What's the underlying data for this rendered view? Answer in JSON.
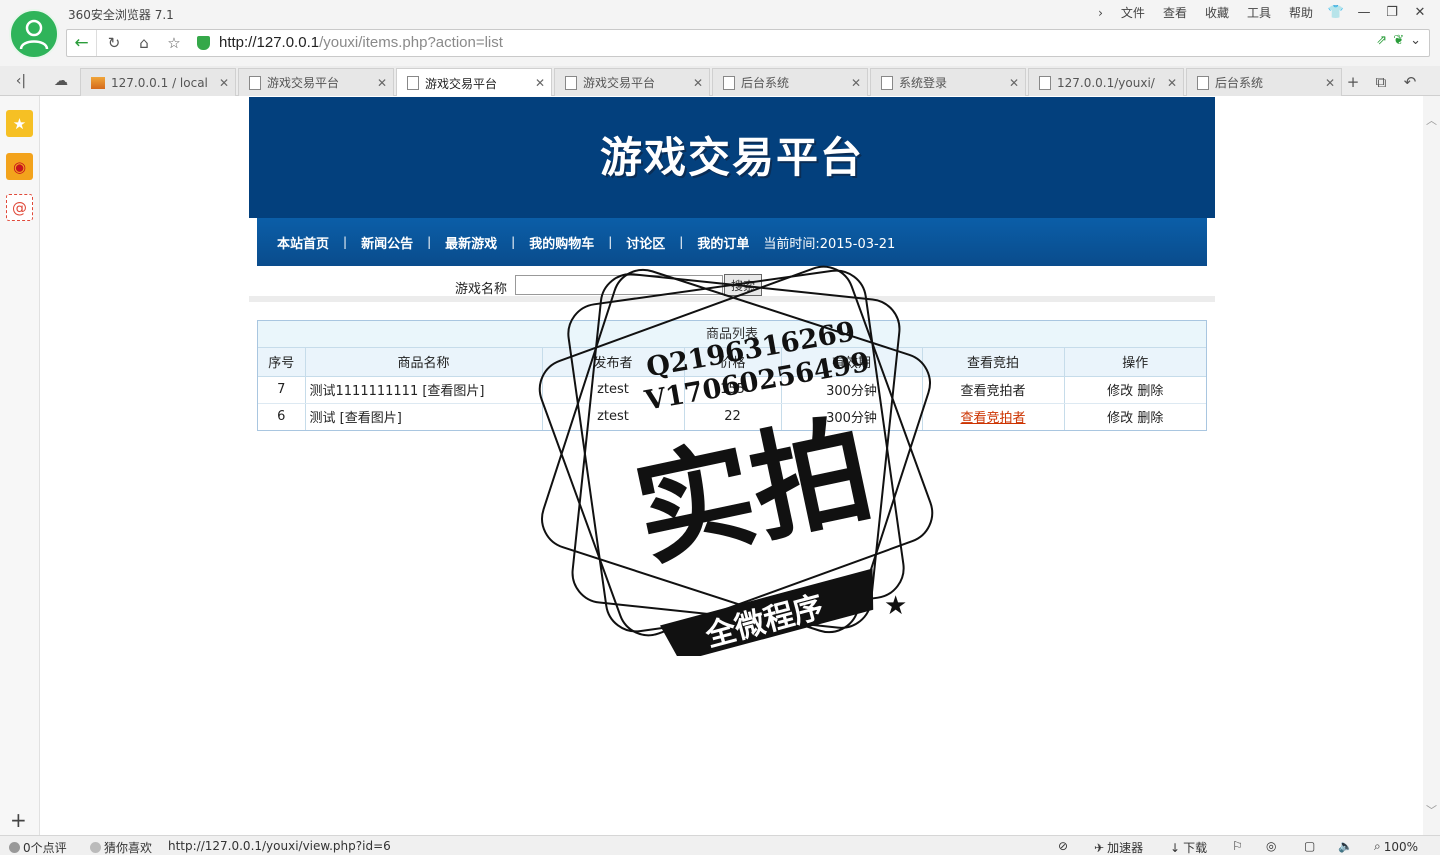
{
  "browser": {
    "title": "360安全浏览器 7.1",
    "menus": [
      "文件",
      "查看",
      "收藏",
      "工具",
      "帮助"
    ],
    "url_host": "http://127.0.0.1",
    "url_path": "/youxi/items.php?action=list"
  },
  "tabs": [
    {
      "label": "127.0.0.1 / local",
      "active": false
    },
    {
      "label": "游戏交易平台",
      "active": false
    },
    {
      "label": "游戏交易平台",
      "active": true
    },
    {
      "label": "游戏交易平台",
      "active": false
    },
    {
      "label": "后台系统",
      "active": false
    },
    {
      "label": "系统登录",
      "active": false
    },
    {
      "label": "127.0.0.1/youxi/",
      "active": false
    },
    {
      "label": "后台系统",
      "active": false
    }
  ],
  "page": {
    "banner_title": "游戏交易平台",
    "nav": [
      "本站首页",
      "新闻公告",
      "最新游戏",
      "我的购物车",
      "讨论区",
      "我的订单"
    ],
    "current_time": "当前时间:2015-03-21",
    "search_label": "游戏名称",
    "search_value": "",
    "search_button": "搜索",
    "panel_title": "商品列表",
    "columns": [
      "序号",
      "商品名称",
      "发布者",
      "价格",
      "有效期",
      "查看竞拍",
      "操作"
    ],
    "rows": [
      {
        "id": "7",
        "name": "测试1111111111 [查看图片]",
        "publisher": "ztest",
        "price": "155",
        "validity": "300分钟",
        "bids": "查看竞拍者",
        "edit": "修改",
        "delete": "删除"
      },
      {
        "id": "6",
        "name": "测试 [查看图片]",
        "publisher": "ztest",
        "price": "22",
        "validity": "300分钟",
        "bids": "查看竞拍者",
        "edit": "修改",
        "delete": "删除"
      }
    ]
  },
  "watermark": {
    "line1": "Q2196316269",
    "line2": "V17060256499",
    "big": "实拍",
    "ribbon": "全微程序"
  },
  "status": {
    "reviews": "0个点评",
    "guess": "猜你喜欢",
    "hover_url": "http://127.0.0.1/youxi/view.php?id=6",
    "accelerator": "加速器",
    "download": "下载",
    "zoom": "100%"
  },
  "colors": {
    "banner": "#03407d",
    "nav": "#0b5ea8",
    "accent_green": "#2fb45a",
    "link_hover": "#cc3300"
  }
}
